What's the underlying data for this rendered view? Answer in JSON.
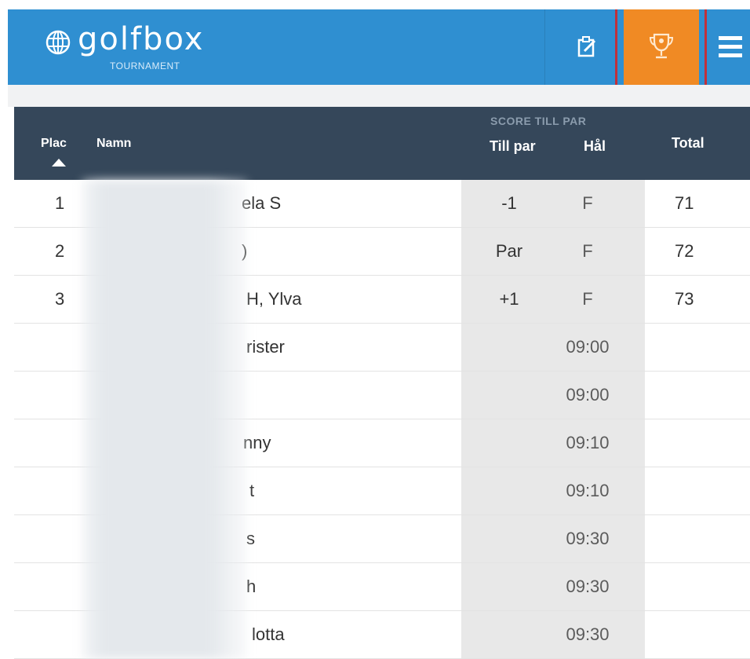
{
  "header": {
    "brand_name": "golfbox",
    "brand_sub": "TOURNAMENT",
    "brand_color": "#2f8fd1",
    "active_tab_color": "#f08a24",
    "highlight_color": "#c0303a",
    "icons": [
      "globe-logo-icon",
      "notes-edit-icon",
      "trophy-icon",
      "hamburger-menu-icon"
    ]
  },
  "table": {
    "columns": {
      "place": "Plac",
      "name": "Namn",
      "group_label": "SCORE TILL PAR",
      "to_par": "Till par",
      "hole": "Hål",
      "total": "Total"
    },
    "sort": "ascending",
    "rows": [
      {
        "place": "1",
        "name": "ela S",
        "to_par": "-1",
        "hole": "F",
        "total": "71"
      },
      {
        "place": "2",
        "name": ")",
        "to_par": "Par",
        "hole": "F",
        "total": "72"
      },
      {
        "place": "3",
        "name": "H, Ylva",
        "to_par": "+1",
        "hole": "F",
        "total": "73"
      },
      {
        "place": "",
        "name": "rister",
        "to_par": "",
        "hole": "09:00",
        "total": ""
      },
      {
        "place": "",
        "name": "",
        "to_par": "",
        "hole": "09:00",
        "total": ""
      },
      {
        "place": "",
        "name": "nny",
        "to_par": "",
        "hole": "09:10",
        "total": ""
      },
      {
        "place": "",
        "name": "t",
        "to_par": "",
        "hole": "09:10",
        "total": ""
      },
      {
        "place": "",
        "name": "s",
        "to_par": "",
        "hole": "09:30",
        "total": ""
      },
      {
        "place": "",
        "name": "h",
        "to_par": "",
        "hole": "09:30",
        "total": ""
      },
      {
        "place": "",
        "name": "lotta",
        "to_par": "",
        "hole": "09:30",
        "total": ""
      }
    ]
  }
}
